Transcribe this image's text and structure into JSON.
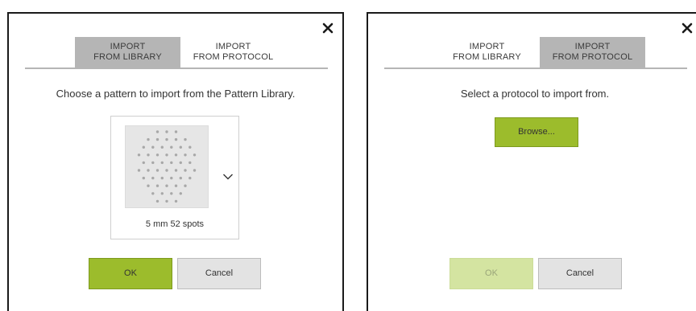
{
  "left_dialog": {
    "tabs": [
      {
        "label_line1": "IMPORT",
        "label_line2": "FROM LIBRARY",
        "active": true
      },
      {
        "label_line1": "IMPORT",
        "label_line2": "FROM PROTOCOL",
        "active": false
      }
    ],
    "prompt": "Choose a pattern to import from the Pattern Library.",
    "pattern": {
      "label": "5 mm 52 spots",
      "icon": "spot-pattern-preview",
      "dropdown_icon": "chevron-down-icon"
    },
    "ok_label": "OK",
    "cancel_label": "Cancel",
    "close_icon": "close-icon"
  },
  "right_dialog": {
    "tabs": [
      {
        "label_line1": "IMPORT",
        "label_line2": "FROM LIBRARY",
        "active": false
      },
      {
        "label_line1": "IMPORT",
        "label_line2": "FROM PROTOCOL",
        "active": true
      }
    ],
    "prompt": "Select a protocol to import from.",
    "browse_label": "Browse...",
    "ok_label": "OK",
    "ok_disabled": true,
    "cancel_label": "Cancel",
    "close_icon": "close-icon"
  },
  "colors": {
    "accent_green": "#9cbc2c",
    "accent_green_disabled": "#d4e4a1",
    "active_tab": "#b5b5b5",
    "cancel_bg": "#e3e3e3"
  }
}
